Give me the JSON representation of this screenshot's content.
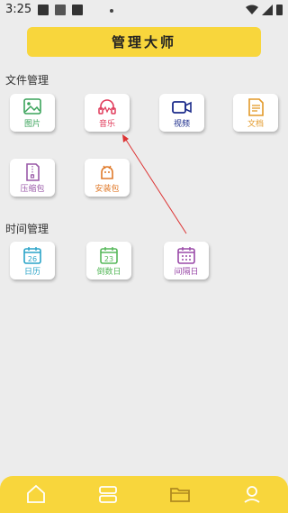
{
  "status": {
    "time": "3:25"
  },
  "title": "管理大师",
  "sections": {
    "file": "文件管理",
    "time": "时间管理"
  },
  "files": [
    {
      "label": "图片",
      "color": "#3aa35a",
      "icon": "image-icon"
    },
    {
      "label": "音乐",
      "color": "#e03a5a",
      "icon": "music-icon"
    },
    {
      "label": "视频",
      "color": "#1a2a8a",
      "icon": "video-icon"
    },
    {
      "label": "文档",
      "color": "#e39a2a",
      "icon": "document-icon"
    },
    {
      "label": "压缩包",
      "color": "#9a5aa8",
      "icon": "zip-icon"
    },
    {
      "label": "安装包",
      "color": "#e07a2a",
      "icon": "android-icon"
    }
  ],
  "timecards": [
    {
      "label": "日历",
      "color": "#2aa4c8",
      "num": "26",
      "icon": "calendar-icon"
    },
    {
      "label": "倒数日",
      "color": "#56b85a",
      "num": "23",
      "icon": "countdown-icon"
    },
    {
      "label": "间隔日",
      "color": "#9a4aa8",
      "num": "",
      "icon": "interval-calendar-icon"
    }
  ],
  "nav": [
    "home-icon",
    "layout-icon",
    "folder-icon",
    "profile-icon"
  ]
}
